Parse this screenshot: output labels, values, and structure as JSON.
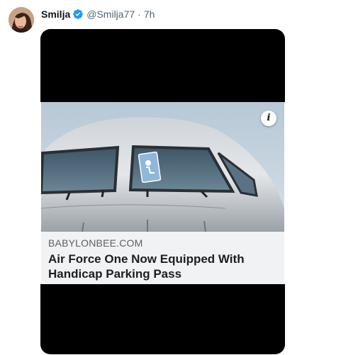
{
  "tweet": {
    "display_name": "Smilja",
    "handle": "@Smilja77",
    "separator": "·",
    "time": "7h",
    "verified": true
  },
  "link_card": {
    "domain": "BABYLONBEE.COM",
    "headline": "Air Force One Now Equipped With Handicap Parking Pass",
    "info_glyph": "i"
  },
  "icons": {
    "verified": "verified-badge-icon",
    "info": "info-icon"
  },
  "colors": {
    "verified_blue": "#1d9bf0",
    "text_primary": "#0f1419",
    "text_secondary": "#536471",
    "media_background": "#000000",
    "card_caption_background": "#f1f2f4"
  }
}
